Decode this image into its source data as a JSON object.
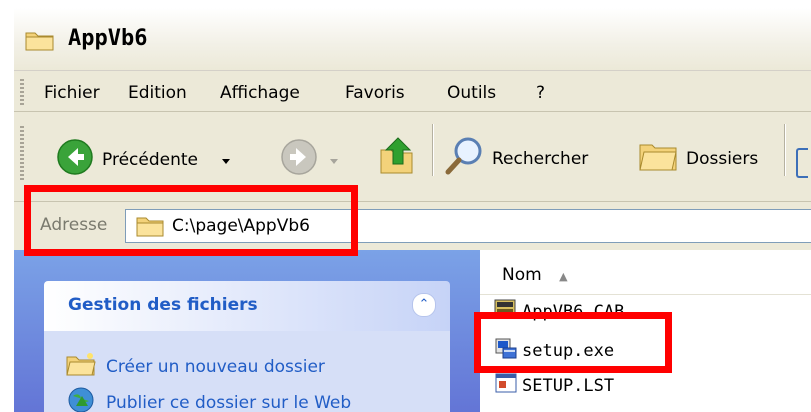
{
  "window": {
    "title": "AppVb6"
  },
  "menu": [
    "Fichier",
    "Edition",
    "Affichage",
    "Favoris",
    "Outils",
    "?"
  ],
  "toolbar": {
    "back_label": "Précédente",
    "search_label": "Rechercher",
    "folders_label": "Dossiers"
  },
  "address": {
    "label": "Adresse",
    "value": "C:\\page\\AppVb6"
  },
  "tasks_panel": {
    "title": "Gestion des fichiers",
    "items": [
      {
        "label": "Créer un nouveau dossier",
        "icon": "new-folder-icon"
      },
      {
        "label": "Publier ce dossier sur le Web",
        "icon": "web-publish-icon"
      }
    ]
  },
  "file_list": {
    "column": "Nom",
    "files": [
      {
        "name": "AppVB6.CAB",
        "icon": "cab-file-icon"
      },
      {
        "name": "setup.exe",
        "icon": "setup-exe-icon"
      },
      {
        "name": "SETUP.LST",
        "icon": "lst-file-icon"
      }
    ]
  },
  "colors": {
    "highlight": "#ff0000",
    "taskpane": "#6375d6",
    "link": "#215dc6"
  }
}
